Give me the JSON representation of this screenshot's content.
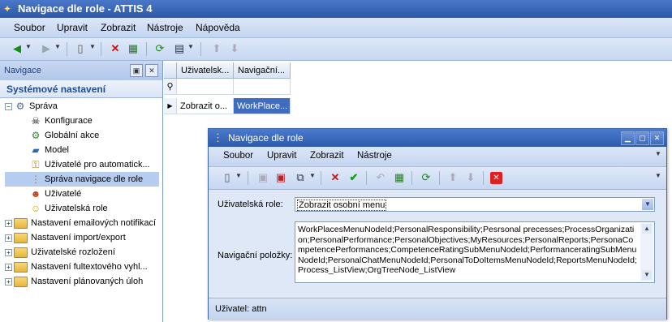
{
  "app": {
    "title": "Navigace dle role - ATTIS 4"
  },
  "menu": [
    "Soubor",
    "Upravit",
    "Zobrazit",
    "Nástroje",
    "Nápověda"
  ],
  "nav": {
    "header": "Navigace",
    "section": "Systémové nastavení",
    "tree": [
      "Správa",
      "Konfigurace",
      "Globální akce",
      "Model",
      "Uživatelé pro automatick...",
      "Správa navigace dle role",
      "Uživatelé",
      "Uživatelská role",
      "Nastavení emailových notifikací",
      "Nastavení import/export",
      "Uživatelské rozložení",
      "Nastavení fultextového vyhl...",
      "Nastavení plánovaných úloh"
    ]
  },
  "grid": {
    "columns": [
      "Uživatelsk...",
      "Navigační..."
    ],
    "row": [
      "Zobrazit o...",
      "WorkPlace..."
    ]
  },
  "dialog": {
    "title": "Navigace dle role",
    "menu": [
      "Soubor",
      "Upravit",
      "Zobrazit",
      "Nástroje"
    ],
    "role_label": "Uživatelská role:",
    "role_value": "Zobrazit osobní menu",
    "items_label": "Navigační položky:",
    "items_value": "WorkPlacesMenuNodeId;PersonalResponsibility;Pesrsonal precesses;ProcessOrganization;PersonalPerformance;PersonalObjectives;MyResources;PersonalReports;PersonaCompetencePerformances;CompetenceRatingSubMenuNodeId;PerformanceratingSubMenuNodeId;PersonalChatMenuNodeId;PersonalToDoItemsMenuNodeId;ReportsMenuNodeId;Process_ListView;OrgTreeNode_ListView",
    "status": "Uživatel: attn"
  }
}
